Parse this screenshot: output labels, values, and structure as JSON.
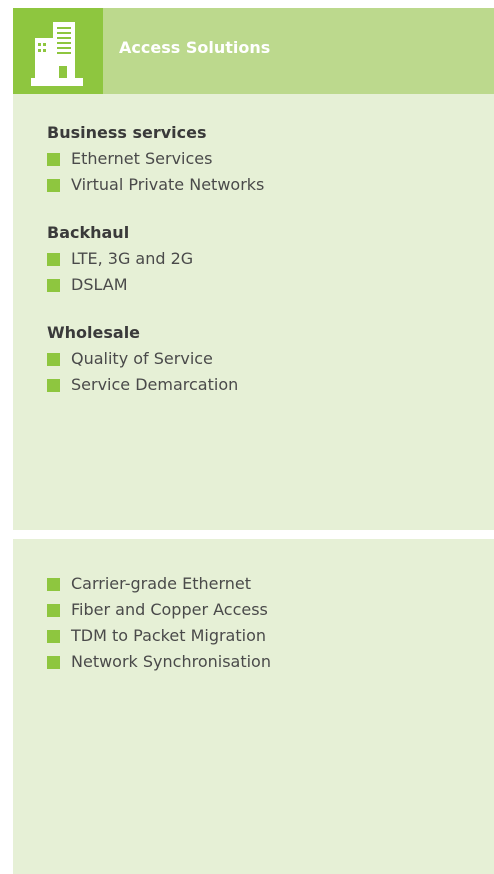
{
  "header": {
    "icon": "building-icon",
    "title": "Access Solutions"
  },
  "groups": [
    {
      "heading": "Business services",
      "items": [
        "Ethernet Services",
        "Virtual Private Networks"
      ]
    },
    {
      "heading": "Backhaul",
      "items": [
        "LTE, 3G and 2G",
        "DSLAM"
      ]
    },
    {
      "heading": "Wholesale",
      "items": [
        "Quality of Service",
        "Service Demarcation"
      ]
    }
  ],
  "features": [
    "Carrier-grade Ethernet",
    "Fiber and Copper Access",
    "TDM to Packet Migration",
    "Network Synchronisation"
  ],
  "colors": {
    "icon_bg": "#8ec63f",
    "header_bg": "#bcd98d",
    "panel_bg": "#e6f0d6",
    "bullet": "#8ec63f"
  }
}
